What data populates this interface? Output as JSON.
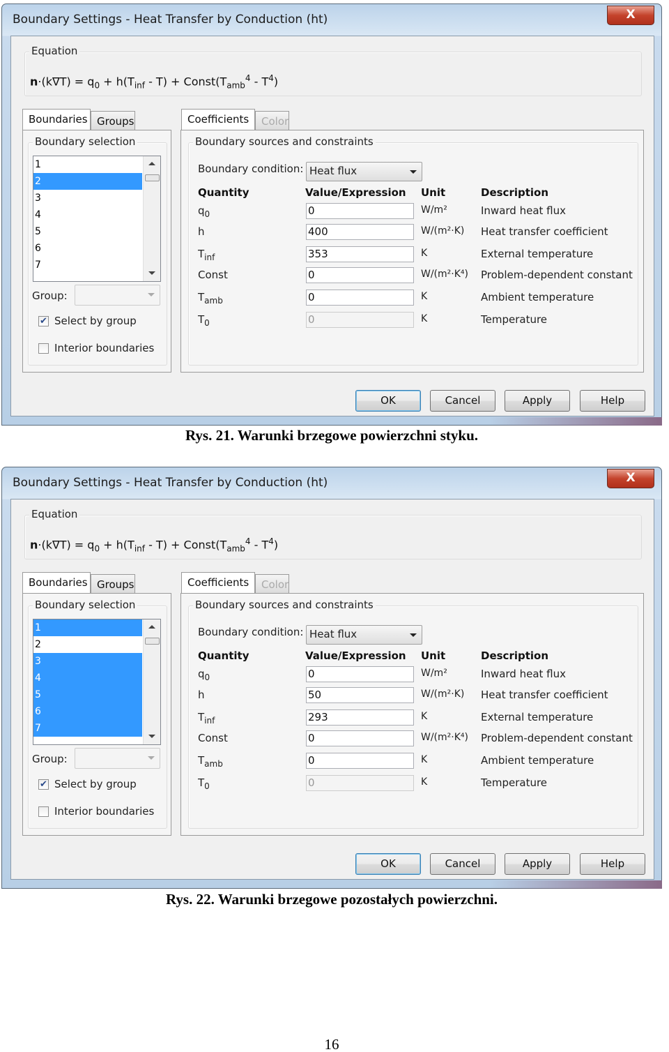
{
  "dialogs": [
    {
      "title": "Boundary Settings - Heat Transfer by Conduction (ht)",
      "close_label": "X",
      "equation_label": "Equation",
      "equation": [
        {
          "t": "n",
          "s": "b"
        },
        {
          "t": "·(k∇T) = q",
          "s": ""
        },
        {
          "t": "0",
          "s": "sub"
        },
        {
          "t": " + h(T",
          "s": ""
        },
        {
          "t": "inf",
          "s": "sub"
        },
        {
          "t": " - T) + Const(T",
          "s": ""
        },
        {
          "t": "amb",
          "s": "sub"
        },
        {
          "t": "4",
          "s": "sup"
        },
        {
          "t": " - T",
          "s": ""
        },
        {
          "t": "4",
          "s": "sup"
        },
        {
          "t": ")",
          "s": ""
        }
      ],
      "left_tabs": [
        "Boundaries",
        "Groups"
      ],
      "boundary_selection_label": "Boundary selection",
      "boundaries": [
        "1",
        "2",
        "3",
        "4",
        "5",
        "6",
        "7"
      ],
      "selected": [
        "2"
      ],
      "group_label": "Group:",
      "group_value": "",
      "select_by_group": {
        "label": "Select by group",
        "checked": true
      },
      "interior_boundaries": {
        "label": "Interior boundaries",
        "checked": false
      },
      "right_tabs": [
        "Coefficients",
        "Color"
      ],
      "sources_label": "Boundary sources and constraints",
      "boundary_condition_label": "Boundary condition:",
      "boundary_condition": "Heat flux",
      "headers": [
        "Quantity",
        "Value/Expression",
        "Unit",
        "Description"
      ],
      "rows": [
        {
          "q": "q",
          "sub": "0",
          "value": "0",
          "unit": "W/m²",
          "desc": "Inward heat flux",
          "disabled": false
        },
        {
          "q": "h",
          "sub": "",
          "value": "400",
          "unit": "W/(m²·K)",
          "desc": "Heat transfer coefficient",
          "disabled": false
        },
        {
          "q": "T",
          "sub": "inf",
          "value": "353",
          "unit": "K",
          "desc": "External temperature",
          "disabled": false
        },
        {
          "q": "Const",
          "sub": "",
          "value": "0",
          "unit": "W/(m²·K⁴)",
          "desc": "Problem-dependent constant",
          "disabled": false
        },
        {
          "q": "T",
          "sub": "amb",
          "value": "0",
          "unit": "K",
          "desc": "Ambient temperature",
          "disabled": false
        },
        {
          "q": "T",
          "sub": "0",
          "value": "0",
          "unit": "K",
          "desc": "Temperature",
          "disabled": true
        }
      ],
      "buttons": [
        "OK",
        "Cancel",
        "Apply",
        "Help"
      ]
    },
    {
      "title": "Boundary Settings - Heat Transfer by Conduction (ht)",
      "close_label": "X",
      "equation_label": "Equation",
      "equation": [
        {
          "t": "n",
          "s": "b"
        },
        {
          "t": "·(k∇T) = q",
          "s": ""
        },
        {
          "t": "0",
          "s": "sub"
        },
        {
          "t": " + h(T",
          "s": ""
        },
        {
          "t": "inf",
          "s": "sub"
        },
        {
          "t": " - T) + Const(T",
          "s": ""
        },
        {
          "t": "amb",
          "s": "sub"
        },
        {
          "t": "4",
          "s": "sup"
        },
        {
          "t": " - T",
          "s": ""
        },
        {
          "t": "4",
          "s": "sup"
        },
        {
          "t": ")",
          "s": ""
        }
      ],
      "left_tabs": [
        "Boundaries",
        "Groups"
      ],
      "boundary_selection_label": "Boundary selection",
      "boundaries": [
        "1",
        "2",
        "3",
        "4",
        "5",
        "6",
        "7"
      ],
      "selected": [
        "1",
        "3",
        "4",
        "5",
        "6",
        "7"
      ],
      "group_label": "Group:",
      "group_value": "",
      "select_by_group": {
        "label": "Select by group",
        "checked": true
      },
      "interior_boundaries": {
        "label": "Interior boundaries",
        "checked": false
      },
      "right_tabs": [
        "Coefficients",
        "Color"
      ],
      "sources_label": "Boundary sources and constraints",
      "boundary_condition_label": "Boundary condition:",
      "boundary_condition": "Heat flux",
      "headers": [
        "Quantity",
        "Value/Expression",
        "Unit",
        "Description"
      ],
      "rows": [
        {
          "q": "q",
          "sub": "0",
          "value": "0",
          "unit": "W/m²",
          "desc": "Inward heat flux",
          "disabled": false
        },
        {
          "q": "h",
          "sub": "",
          "value": "50",
          "unit": "W/(m²·K)",
          "desc": "Heat transfer coefficient",
          "disabled": false
        },
        {
          "q": "T",
          "sub": "inf",
          "value": "293",
          "unit": "K",
          "desc": "External temperature",
          "disabled": false
        },
        {
          "q": "Const",
          "sub": "",
          "value": "0",
          "unit": "W/(m²·K⁴)",
          "desc": "Problem-dependent constant",
          "disabled": false
        },
        {
          "q": "T",
          "sub": "amb",
          "value": "0",
          "unit": "K",
          "desc": "Ambient temperature",
          "disabled": false
        },
        {
          "q": "T",
          "sub": "0",
          "value": "0",
          "unit": "K",
          "desc": "Temperature",
          "disabled": true
        }
      ],
      "buttons": [
        "OK",
        "Cancel",
        "Apply",
        "Help"
      ]
    }
  ],
  "captions": [
    "Rys. 21. Warunki brzegowe powierzchni styku.",
    "Rys. 22. Warunki brzegowe pozostałych powierzchni."
  ],
  "page_number": "16"
}
